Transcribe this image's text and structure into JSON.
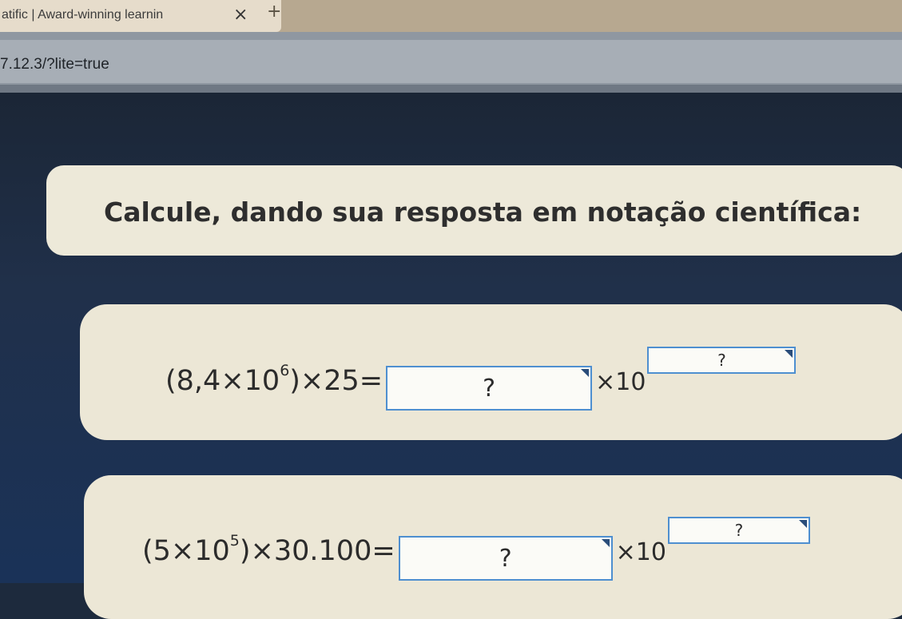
{
  "browser": {
    "tab_title": "atific | Award-winning learnin",
    "tab_close": "×",
    "new_tab": "+",
    "address": "7.12.3/?lite=true"
  },
  "question": {
    "prompt": "Calcule, dando sua resposta em notação científica:"
  },
  "exercises": [
    {
      "lhs_open": "(8,4×10",
      "lhs_exp": "6",
      "lhs_rest": ")×25=",
      "mantissa_placeholder": "?",
      "times_ten": "×10",
      "exponent_placeholder": "?"
    },
    {
      "lhs_open": "(5×10",
      "lhs_exp": "5",
      "lhs_rest": ")×30.100=",
      "mantissa_placeholder": "?",
      "times_ten": "×10",
      "exponent_placeholder": "?"
    }
  ],
  "colors": {
    "card_bg": "#ede9d9",
    "input_border": "#4e8fd0",
    "page_bg": "#1d2a3d"
  }
}
